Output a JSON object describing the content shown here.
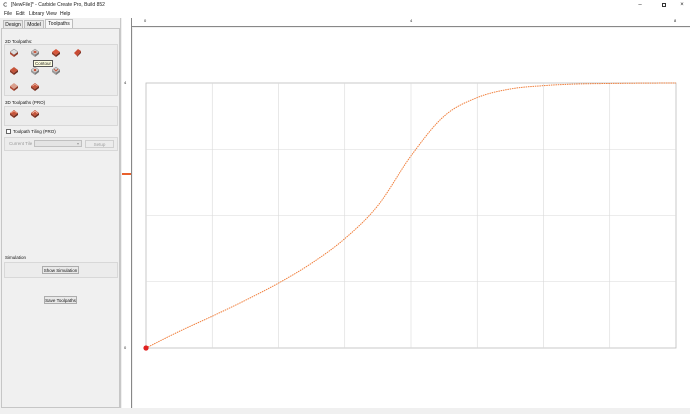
{
  "window": {
    "title": "[NewFile]* - Carbide Create Pro, Build 852",
    "controls": [
      "minimize-icon",
      "maximize-icon",
      "close-icon"
    ]
  },
  "menu": [
    "File",
    "Edit",
    "Library",
    "View",
    "Help"
  ],
  "tabs": [
    "Design",
    "Model",
    "Toolpaths"
  ],
  "active_tab": "Toolpaths",
  "toolpaths_2d": {
    "label": "2D Toolpaths:",
    "icons": [
      "contour-toolpath-icon",
      "pocket-toolpath-icon",
      "drill-toolpath-icon",
      "vcarve-toolpath-icon",
      "texture-toolpath-icon",
      "advanced-vcarve-toolpath-icon",
      "chamfer-toolpath-icon",
      "fillet-toolpath-icon",
      "engrave-toolpath-icon"
    ],
    "tooltip": "Contour"
  },
  "toolpaths_3d": {
    "label": "3D Toolpaths (PRO)",
    "icons": [
      "rough-3d-toolpath-icon",
      "finish-3d-toolpath-icon"
    ]
  },
  "tiling": {
    "label": "Toolpath Tiling (PRO)",
    "checked": false,
    "current_tile_label": "Current Tile",
    "setup_label": "Setup"
  },
  "simulation": {
    "label": "Simulation",
    "show_button": "Show Simulation"
  },
  "save_toolpaths": "Save Toolpaths",
  "ruler": {
    "top_labels": [
      "0",
      "4",
      "8"
    ],
    "left_labels": [
      "4",
      "0"
    ]
  },
  "colors": {
    "accent": "#e8602c",
    "curve": "#f07f3c",
    "grid": "#d9d9d9",
    "origin": "#e02020"
  },
  "chart_data": {
    "type": "line",
    "series": [
      {
        "x": [
          0,
          0.5,
          1,
          1.5,
          2,
          2.5,
          3,
          3.5,
          4,
          4.5,
          5,
          5.5,
          6,
          6.5,
          7,
          7.5,
          8
        ],
        "y": [
          0,
          0.25,
          0.48,
          0.72,
          0.98,
          1.28,
          1.65,
          2.15,
          2.9,
          3.5,
          3.78,
          3.91,
          3.96,
          3.985,
          3.993,
          3.998,
          4.0
        ]
      }
    ],
    "xlim": [
      0,
      8
    ],
    "ylim": [
      0,
      4
    ],
    "grid": true
  }
}
